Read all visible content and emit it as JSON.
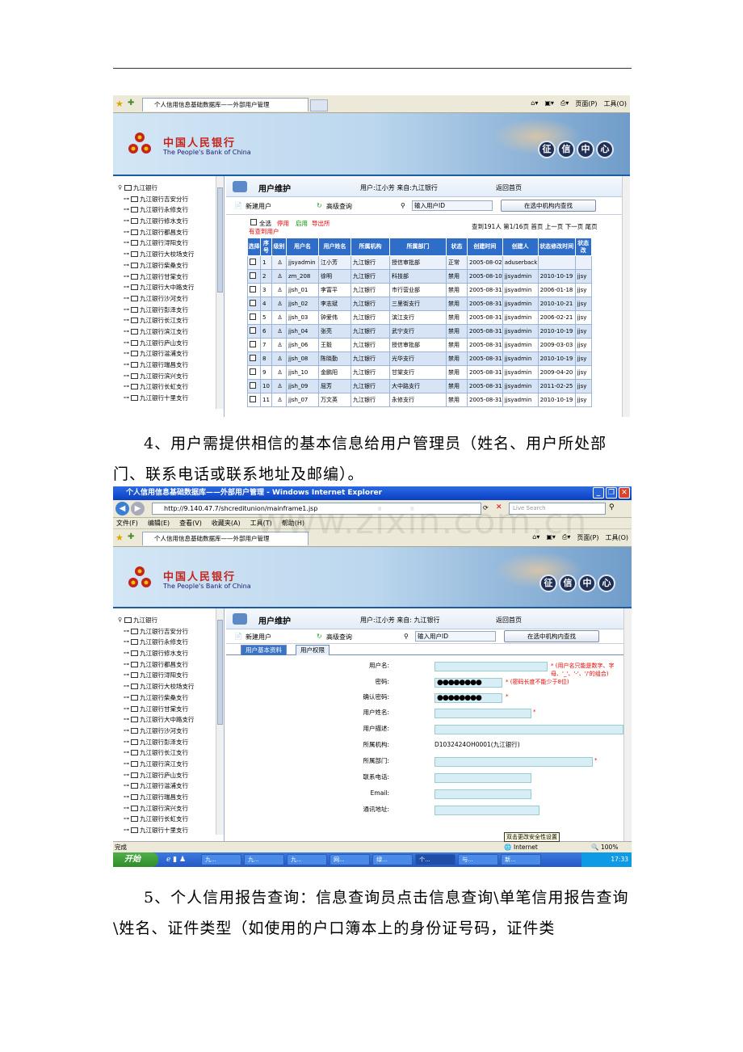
{
  "screenshot1": {
    "tab_title": "个人信用信息基础数据库——外部用户管理",
    "tools": {
      "page": "页面(P)",
      "tools": "工具(O)"
    },
    "bank": {
      "name_cn": "中国人民银行",
      "name_en": "The People's Bank of China"
    },
    "credit_center": [
      "征",
      "信",
      "中",
      "心"
    ],
    "tree": {
      "root": "九江银行",
      "items": [
        "九江银行吉安分行",
        "九江银行永修支行",
        "九江银行修水支行",
        "九江银行都昌支行",
        "九江银行浔阳支行",
        "九江银行大校场支行",
        "九江银行柴桑支行",
        "九江银行甘棠支行",
        "九江银行大中路支行",
        "九江银行沙河支行",
        "九江银行彭泽支行",
        "九江银行长江支行",
        "九江银行滨江支行",
        "九江银行庐山支行",
        "九江银行湓浦支行",
        "九江银行瑞昌支行",
        "九江银行滨兴支行",
        "九江银行长虹支行",
        "九江银行十里支行"
      ]
    },
    "header": {
      "title": "用户维护",
      "user": "用户:江小芳 来自:九江银行",
      "home": "返回首页"
    },
    "toolbar": {
      "new_user": "新建用户",
      "advanced_search": "高级查询",
      "input_placeholder": "输入用户ID",
      "search_btn": "在选中机构内查找"
    },
    "table_bar": {
      "select_all": "全选",
      "disable": "停用",
      "enable": "启用",
      "export": "导出所",
      "found": "有查到用户",
      "paging": "查到191人  第1/16页  首页 上一页  下一页  尾页"
    },
    "columns": [
      "选择",
      "序号",
      "级别",
      "用户名",
      "用户姓名",
      "所属机构",
      "所属部门",
      "状态",
      "创建时间",
      "创建人",
      "状态修改时间",
      "状态改"
    ],
    "rows": [
      [
        "1",
        "jjsyadmin",
        "江小芳",
        "九江银行",
        "授信审批部",
        "正常",
        "2005-08-02",
        "aduserback",
        "",
        ""
      ],
      [
        "2",
        "zm_208",
        "徐明",
        "九江银行",
        "科技部",
        "禁用",
        "2005-08-10",
        "jjsyadmin",
        "2010-10-19",
        "jjsy"
      ],
      [
        "3",
        "jjsh_01",
        "李富平",
        "九江银行",
        "市行营业部",
        "禁用",
        "2005-08-31",
        "jjsyadmin",
        "2006-01-18",
        "jjsy"
      ],
      [
        "4",
        "jjsh_02",
        "李志斌",
        "九江银行",
        "三里街支行",
        "禁用",
        "2005-08-31",
        "jjsyadmin",
        "2010-10-21",
        "jjsy"
      ],
      [
        "5",
        "jjsh_03",
        "钟爱伟",
        "九江银行",
        "滨江支行",
        "禁用",
        "2005-08-31",
        "jjsyadmin",
        "2006-02-21",
        "jjsy"
      ],
      [
        "6",
        "jjsh_04",
        "张亮",
        "九江银行",
        "武宁支行",
        "禁用",
        "2005-08-31",
        "jjsyadmin",
        "2010-10-19",
        "jjsy"
      ],
      [
        "7",
        "jjsh_06",
        "王毅",
        "九江银行",
        "授信审批部",
        "禁用",
        "2005-08-31",
        "jjsyadmin",
        "2009-03-03",
        "jjsy"
      ],
      [
        "8",
        "jjsh_08",
        "陈晓勤",
        "九江银行",
        "光华支行",
        "禁用",
        "2005-08-31",
        "jjsyadmin",
        "2010-10-19",
        "jjsy"
      ],
      [
        "9",
        "jjsh_10",
        "金鹏阳",
        "九江银行",
        "甘棠支行",
        "禁用",
        "2005-08-31",
        "jjsyadmin",
        "2009-04-20",
        "jjsy"
      ],
      [
        "10",
        "jjsh_09",
        "屈芳",
        "九江银行",
        "大中路支行",
        "禁用",
        "2005-08-31",
        "jjsyadmin",
        "2011-02-25",
        "jjsy"
      ],
      [
        "11",
        "jjsh_07",
        "万文英",
        "九江银行",
        "永修支行",
        "禁用",
        "2005-08-31",
        "jjsyadmin",
        "2010-10-19",
        "jjsy"
      ]
    ]
  },
  "paragraph1": "4、用户需提供相信的基本信息给用户管理员（姓名、用户所处部门、联系电话或联系地址及邮编）。",
  "screenshot2": {
    "window_title": "个人信用信息基础数据库——外部用户管理 - Windows Internet Explorer",
    "address": "http://9.140.47.7/shcreditunion/mainframe1.jsp",
    "live_search": "Live Search",
    "menu": [
      "文件(F)",
      "编辑(E)",
      "查看(V)",
      "收藏夹(A)",
      "工具(T)",
      "帮助(H)"
    ],
    "tab_title": "个人信用信息基础数据库——外部用户管理",
    "tools": {
      "page": "页面(P)",
      "tools": "工具(O)"
    },
    "bank": {
      "name_cn": "中国人民银行",
      "name_en": "The People's Bank of China"
    },
    "credit_center": [
      "征",
      "信",
      "中",
      "心"
    ],
    "tree": {
      "root": "九江银行",
      "items": [
        "九江银行吉安分行",
        "九江银行永修支行",
        "九江银行修水支行",
        "九江银行都昌支行",
        "九江银行浔阳支行",
        "九江银行大校场支行",
        "九江银行柴桑支行",
        "九江银行甘棠支行",
        "九江银行大中路支行",
        "九江银行沙河支行",
        "九江银行彭泽支行",
        "九江银行长江支行",
        "九江银行滨江支行",
        "九江银行庐山支行",
        "九江银行湓浦支行",
        "九江银行瑞昌支行",
        "九江银行滨兴支行",
        "九江银行长虹支行",
        "九江银行十里支行"
      ]
    },
    "header": {
      "title": "用户维护",
      "user": "用户:江小芳 来自: 九江银行",
      "home": "返回首页"
    },
    "toolbar": {
      "new_user": "新建用户",
      "advanced_search": "高级查询",
      "input_placeholder": "输入用户ID",
      "search_btn": "在选中机构内查找"
    },
    "subtabs": [
      "用户基本资料",
      "用户权限"
    ],
    "form": {
      "username_label": "用户名:",
      "username_hint": "(用户名只能是数字、字母、'_'、'-'、'/'的组合)",
      "password_label": "密码:",
      "password_value": "●●●●●●●●",
      "password_hint": "(密码长度不能少于8位)",
      "confirm_label": "确认密码:",
      "confirm_value": "●●●●●●●●",
      "realname_label": "用户姓名:",
      "desc_label": "用户描述:",
      "org_label": "所属机构:",
      "org_value": "D1032424OH0001(九江银行)",
      "dept_label": "所属部门:",
      "phone_label": "联系电话:",
      "email_label": "Email:",
      "addr_label": "通讯地址:"
    },
    "status": {
      "done": "完成",
      "tooltip": "双击更改安全性设置",
      "zone": "Internet",
      "zoom": "100%"
    },
    "taskbar": {
      "start": "开始",
      "buttons": [
        "九...",
        "九...",
        "九...",
        "网...",
        "绿...",
        "个...",
        "与...",
        "新..."
      ],
      "clock": "17:33"
    }
  },
  "paragraph2": "5、个人信用报告查询：信息查询员点击信息查询\\单笔信用报告查询\\姓名、证件类型（如使用的户口簿本上的身份证号码，证件类",
  "watermark": "www.zixin.com.cn"
}
